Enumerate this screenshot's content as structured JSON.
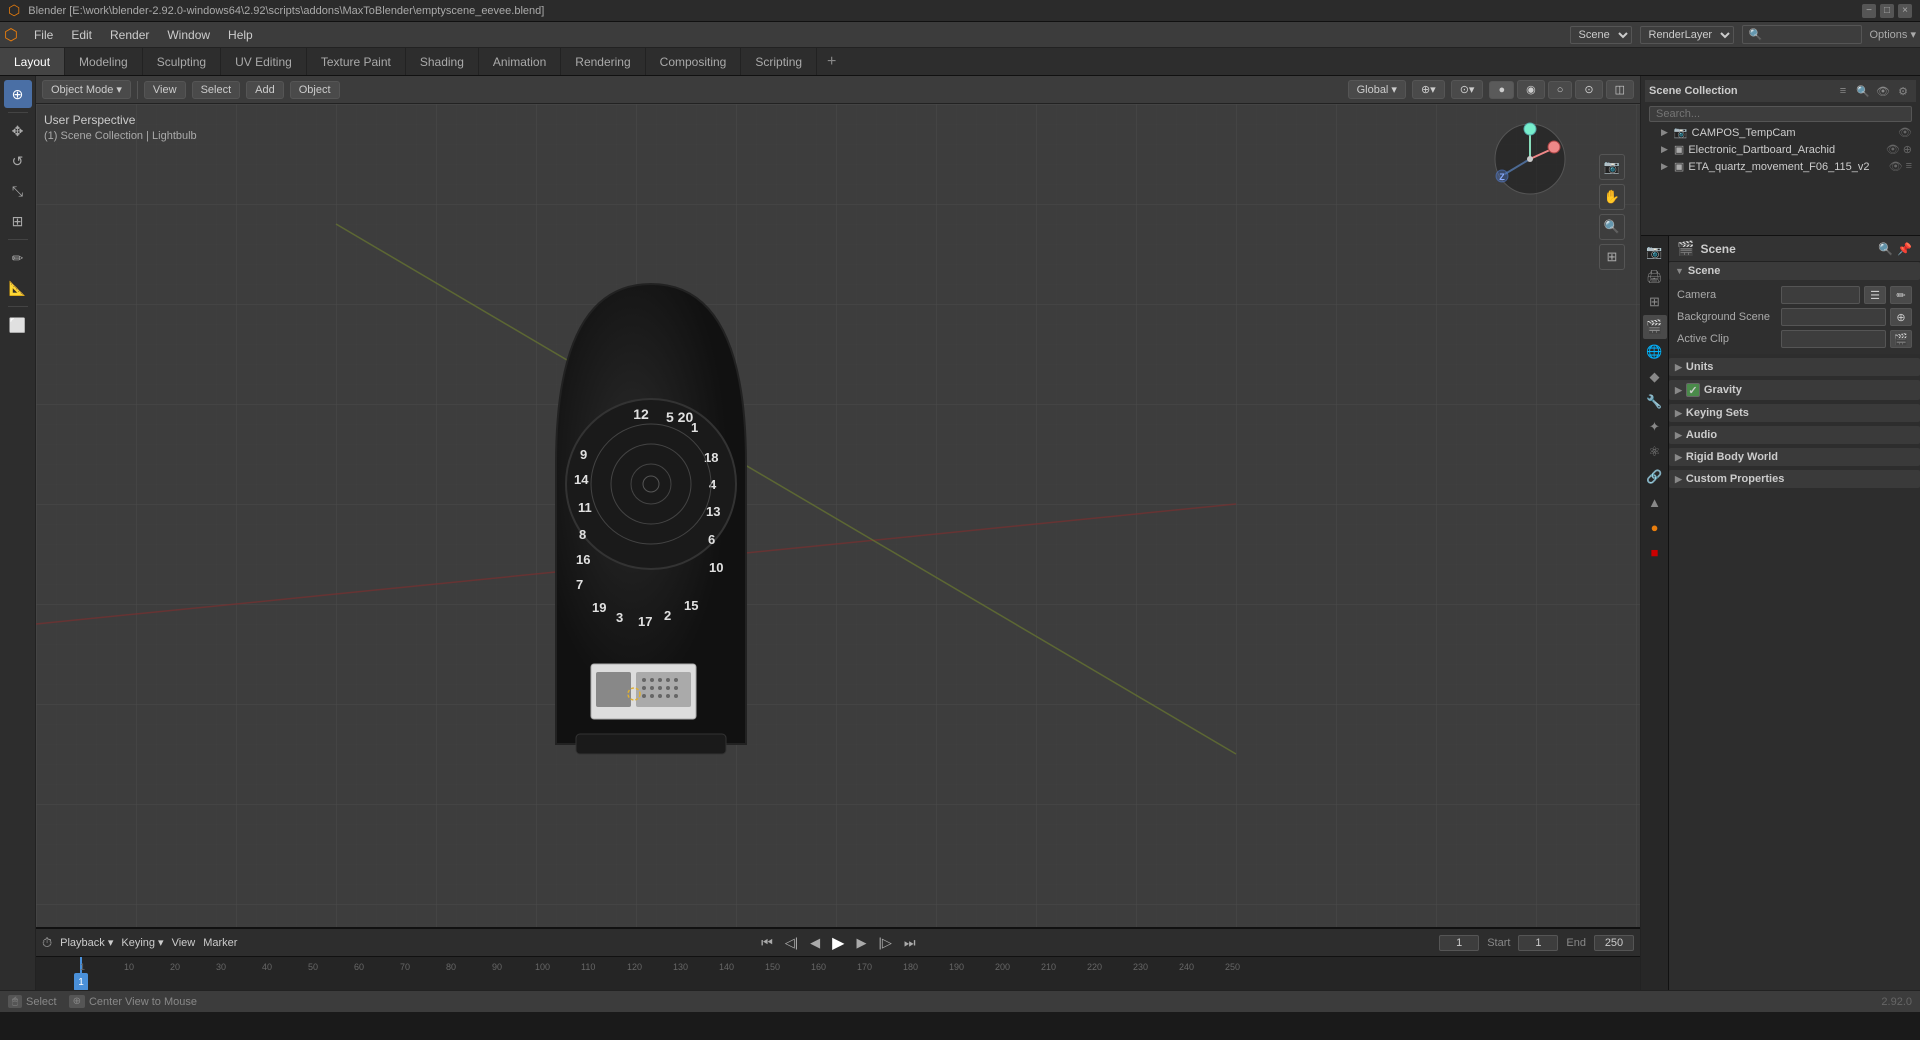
{
  "titlebar": {
    "title": "Blender [E:\\work\\blender-2.92.0-windows64\\2.92\\scripts\\addons\\MaxToBlender\\emptyscene_eevee.blend]",
    "version": "2.92.0"
  },
  "menubar": {
    "items": [
      "Blender",
      "File",
      "Edit",
      "Render",
      "Window",
      "Help"
    ]
  },
  "workspaces": {
    "tabs": [
      "Layout",
      "Modeling",
      "Sculpting",
      "UV Editing",
      "Texture Paint",
      "Shading",
      "Animation",
      "Rendering",
      "Compositing",
      "Scripting"
    ],
    "active": "Layout"
  },
  "viewport": {
    "mode": "Object Mode",
    "view_menu": "View",
    "select_menu": "Select",
    "add_menu": "Add",
    "object_menu": "Object",
    "perspective": "User Perspective",
    "collection_info": "(1) Scene Collection | Lightbulb",
    "global_label": "Global",
    "transform_icon": "⊕"
  },
  "outliner": {
    "title": "Scene Collection",
    "search_placeholder": "Search...",
    "items": [
      {
        "name": "CAMPOS_TempCam",
        "type": "camera",
        "indent": 1,
        "arrow": false,
        "visible": true
      },
      {
        "name": "Electronic_Dartboard_Arachid",
        "type": "mesh",
        "indent": 1,
        "arrow": true,
        "visible": true
      },
      {
        "name": "ETA_quartz_movement_F06_115_v2",
        "type": "mesh",
        "indent": 1,
        "arrow": true,
        "visible": true
      }
    ]
  },
  "properties": {
    "active_icon": "scene",
    "icons": [
      "render",
      "output",
      "view_layer",
      "scene",
      "world",
      "object",
      "modifier",
      "particles",
      "physics",
      "constraints",
      "data",
      "material",
      "shaderfx"
    ],
    "title": "Scene",
    "sections": [
      {
        "name": "Scene",
        "expanded": true,
        "rows": [
          {
            "label": "Camera",
            "value": "",
            "has_btn": true
          },
          {
            "label": "Background Scene",
            "value": "",
            "has_btn": true
          },
          {
            "label": "Active Clip",
            "value": "",
            "has_btn": true
          }
        ]
      },
      {
        "name": "Units",
        "expanded": false
      },
      {
        "name": "Gravity",
        "expanded": false,
        "checkbox": true,
        "checked": true
      },
      {
        "name": "Keying Sets",
        "expanded": false
      },
      {
        "name": "Audio",
        "expanded": false
      },
      {
        "name": "Rigid Body World",
        "expanded": false
      },
      {
        "name": "Custom Properties",
        "expanded": false
      }
    ]
  },
  "timeline": {
    "playback_label": "Playback",
    "keying_label": "Keying",
    "view_label": "View",
    "marker_label": "Marker",
    "current_frame": "1",
    "start_label": "Start",
    "start_value": "1",
    "end_label": "End",
    "end_value": "250",
    "ruler_marks": [
      "1",
      "10",
      "20",
      "30",
      "40",
      "50",
      "60",
      "70",
      "80",
      "90",
      "100",
      "110",
      "120",
      "130",
      "140",
      "150",
      "160",
      "170",
      "180",
      "190",
      "200",
      "210",
      "220",
      "230",
      "240",
      "250"
    ]
  },
  "statusbar": {
    "select_label": "Select",
    "center_view_label": "Center View to Mouse",
    "version": "2.92.0",
    "left_mouse": "🖱",
    "middle_mouse": "🖱"
  },
  "scene_name": "Scene",
  "render_layer": "RenderLayer",
  "icons": {
    "camera": "📷",
    "mesh": "▣",
    "collection": "📁",
    "scene": "🎬",
    "cursor": "⊕",
    "move": "✥",
    "rotate": "↺",
    "scale": "⤡",
    "transform": "⊞",
    "annotate": "✏",
    "measure": "📏",
    "add_cube": "⬜",
    "eye": "👁",
    "filter": "≡",
    "triangle_right": "▶",
    "triangle_down": "▼",
    "play": "▶",
    "pause": "⏸",
    "stop": "⏹",
    "jump_start": "⏮",
    "jump_end": "⏭",
    "prev_frame": "◀",
    "next_frame": "▶",
    "prev_keyframe": "◁",
    "next_keyframe": "▷"
  }
}
